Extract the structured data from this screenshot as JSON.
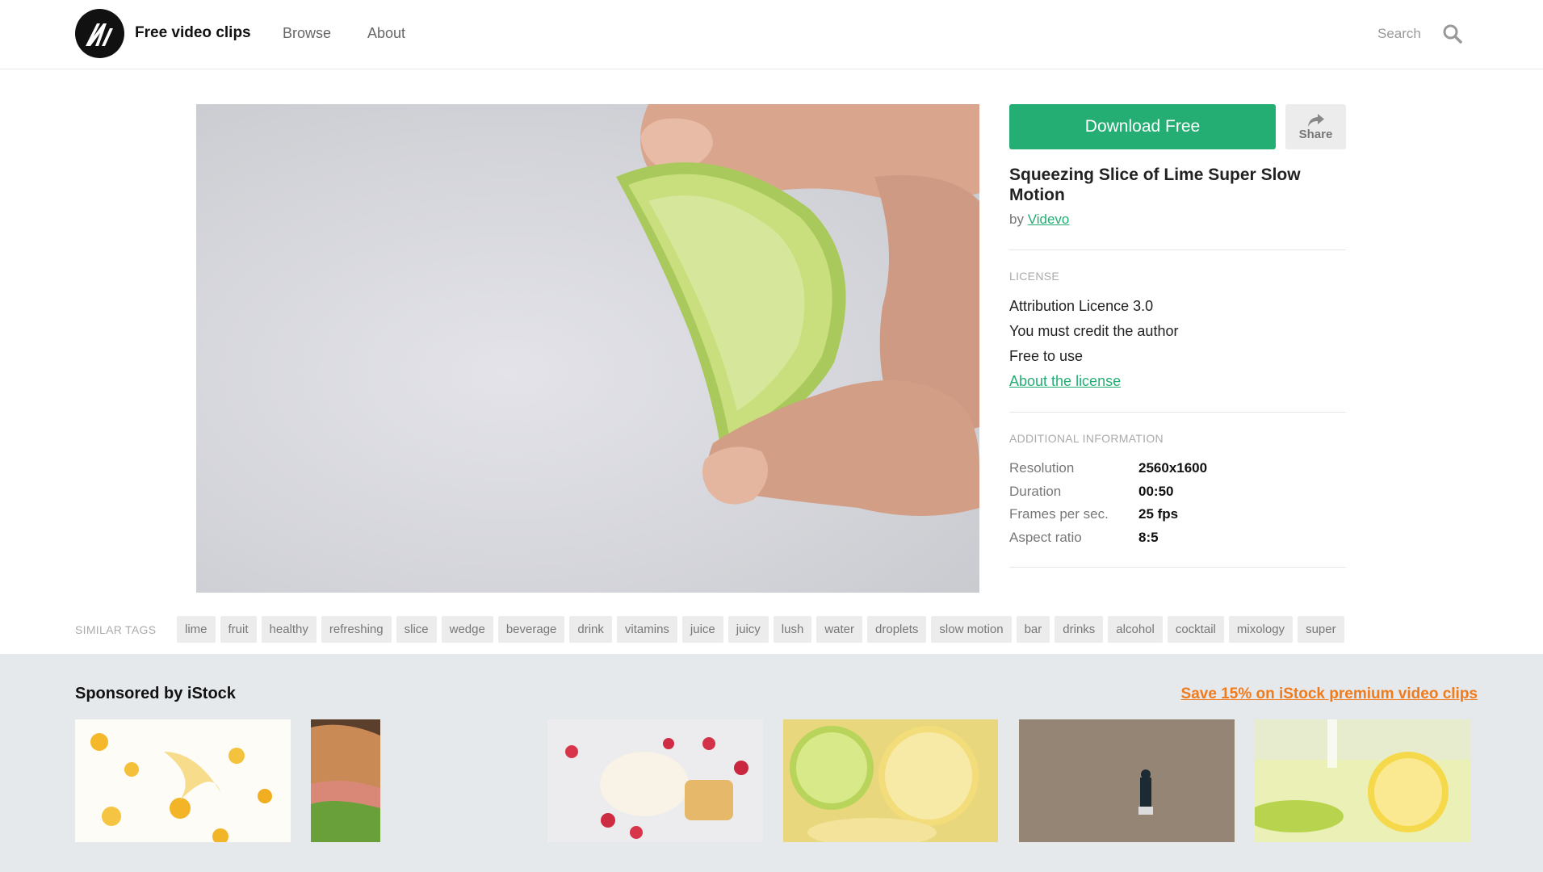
{
  "header": {
    "brand": "Free video clips",
    "nav": [
      "Browse",
      "About"
    ],
    "search_label": "Search"
  },
  "video": {
    "title": "Squeezing Slice of Lime Super Slow Motion",
    "by_prefix": "by",
    "author": "Videvo"
  },
  "actions": {
    "download_label": "Download Free",
    "share_label": "Share"
  },
  "license": {
    "heading": "LICENSE",
    "lines": [
      "Attribution Licence 3.0",
      "You must credit the author",
      "Free to use"
    ],
    "link": "About the license"
  },
  "info": {
    "heading": "ADDITIONAL INFORMATION",
    "rows": [
      {
        "label": "Resolution",
        "value": "2560x1600"
      },
      {
        "label": "Duration",
        "value": "00:50"
      },
      {
        "label": "Frames per sec.",
        "value": "25 fps"
      },
      {
        "label": "Aspect ratio",
        "value": "8:5"
      }
    ]
  },
  "tags": {
    "heading": "SIMILAR TAGS",
    "items": [
      "lime",
      "fruit",
      "healthy",
      "refreshing",
      "slice",
      "wedge",
      "beverage",
      "drink",
      "vitamins",
      "juice",
      "juicy",
      "lush",
      "water",
      "droplets",
      "slow motion",
      "bar",
      "drinks",
      "alcohol",
      "cocktail",
      "mixology",
      "super"
    ]
  },
  "sponsored": {
    "heading": "Sponsored by iStock",
    "promo": "Save 15% on iStock premium video clips"
  },
  "colors": {
    "accent": "#24ae74",
    "promo": "#f07b1c",
    "sponsored_bg": "#e6e9ec"
  }
}
